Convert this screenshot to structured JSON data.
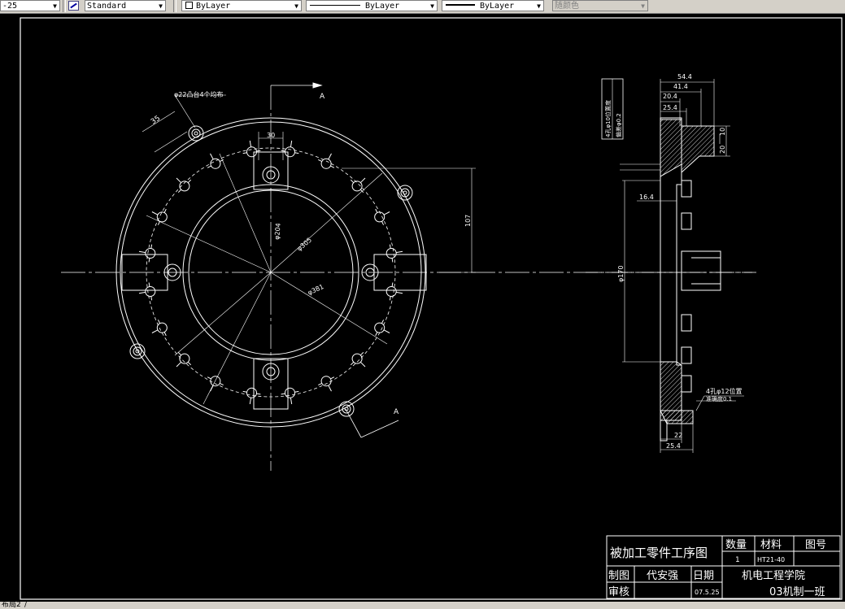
{
  "toolbar": {
    "scale_value": "-25",
    "text_style": "Standard",
    "layer": "ByLayer",
    "linetype": "ByLayer",
    "lineweight": "ByLayer",
    "plot_style": "随颜色"
  },
  "drawing": {
    "callout_bosses": "φ22凸台4个均布",
    "dim_35": "35",
    "dim_30": "30",
    "section_a_top": "A",
    "section_a_bottom": "A",
    "dim_107": "107",
    "dim_d204": "φ204",
    "dim_d305": "φ305",
    "dim_d381": "φ381",
    "side_dim_54_4": "54.4",
    "side_dim_41_4": "41.4",
    "side_dim_20_4": "20.4",
    "side_dim_25_4_top": "25.4",
    "side_dim_20": "20",
    "side_dim_10": "10",
    "side_dim_16_4": "16.4",
    "side_dim_d170": "φ170",
    "side_dim_22": "22",
    "side_dim_25_4_bottom": "25.4",
    "note_box_line1": "4孔φ10位置度",
    "note_box_line2": "偏差φ0.2",
    "note_holes": "4孔φ12位置",
    "note_holes_tol": "准确度0.1"
  },
  "title_block": {
    "title": "被加工零件工序图",
    "qty_label": "数量",
    "material_label": "材料",
    "drawing_no_label": "图号",
    "qty_value": "1",
    "material_value": "HT21-40",
    "drawn_label": "制图",
    "drawn_by": "代安强",
    "date_label": "日期",
    "school": "机电工程学院",
    "review_label": "审核",
    "date_value": "07.5.25",
    "class_name": "03机制一班"
  },
  "status": {
    "layout_tab": "布局2"
  }
}
